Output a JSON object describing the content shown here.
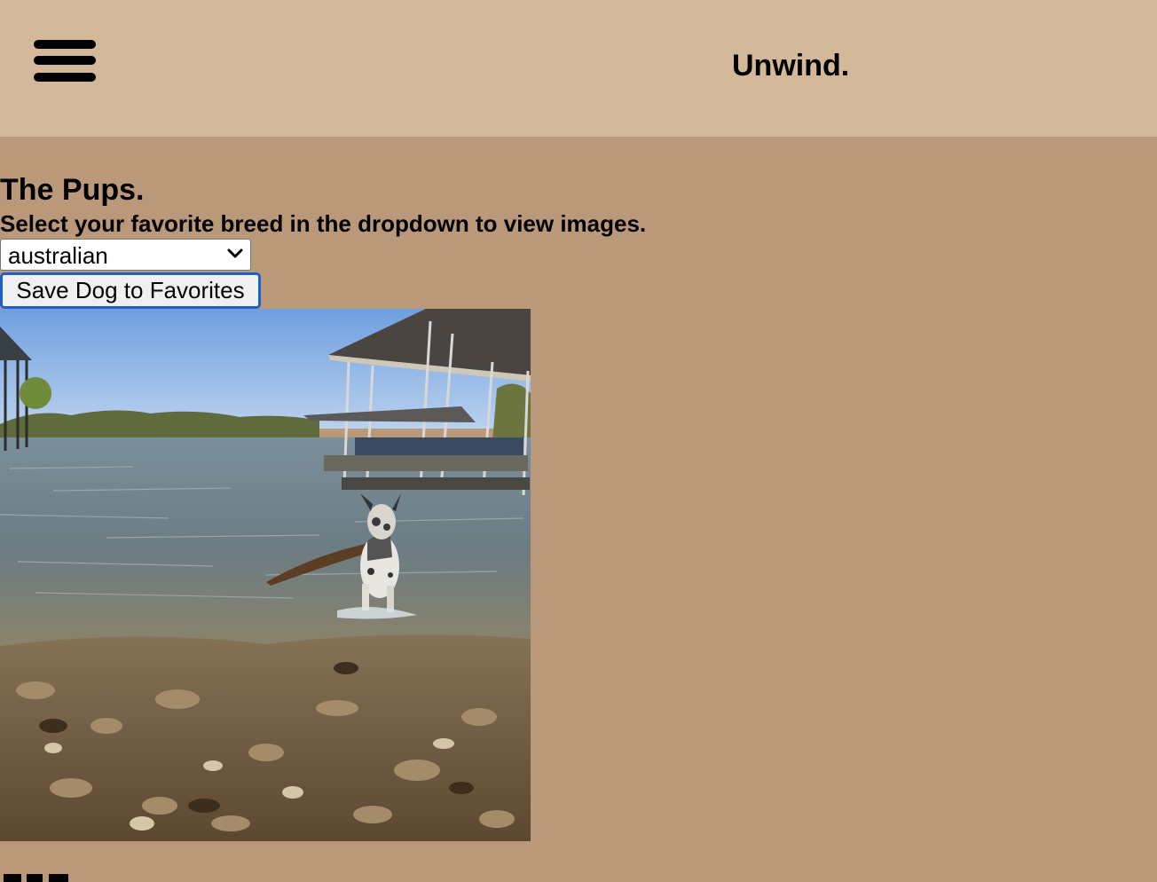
{
  "header": {
    "menu_icon": "hamburger-menu-icon",
    "title": "Unwind.",
    "background": "#d3b899"
  },
  "main": {
    "background": "#ba987a",
    "section_title": "The Pups.",
    "instructions": "Select your favorite breed in the dropdown to view images.",
    "breed_select": {
      "selected_value": "australian",
      "icon": "chevron-down-icon"
    },
    "save_button_label": "Save Dog to Favorites",
    "focus_color": "#1f5fc9"
  }
}
